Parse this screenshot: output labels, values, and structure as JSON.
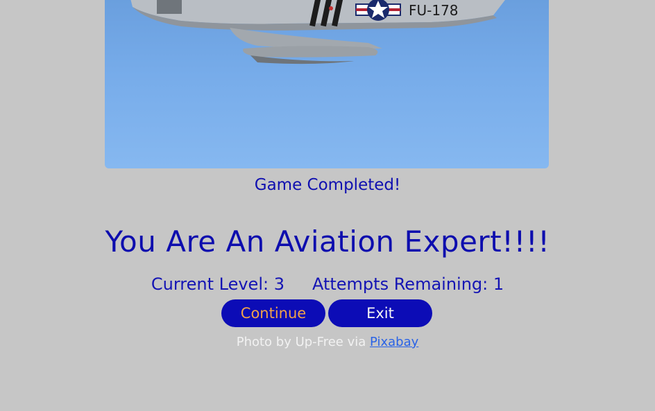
{
  "photo": {
    "tail_marking": "FU-178"
  },
  "game": {
    "status": "Game Completed!",
    "headline": "You Are An Aviation Expert!!!!",
    "level_label": "Current Level: 3",
    "attempts_label": "Attempts Remaining: 1"
  },
  "buttons": {
    "continue": "Continue",
    "exit": "Exit"
  },
  "credit": {
    "prefix": "Photo by Up-Free via ",
    "link": "Pixabay"
  },
  "colors": {
    "background": "#c6c6c6",
    "text_blue": "#0d0dae",
    "button_bg": "#0c0cb6",
    "continue_text": "#f0a24a",
    "link": "#2a63e6"
  }
}
